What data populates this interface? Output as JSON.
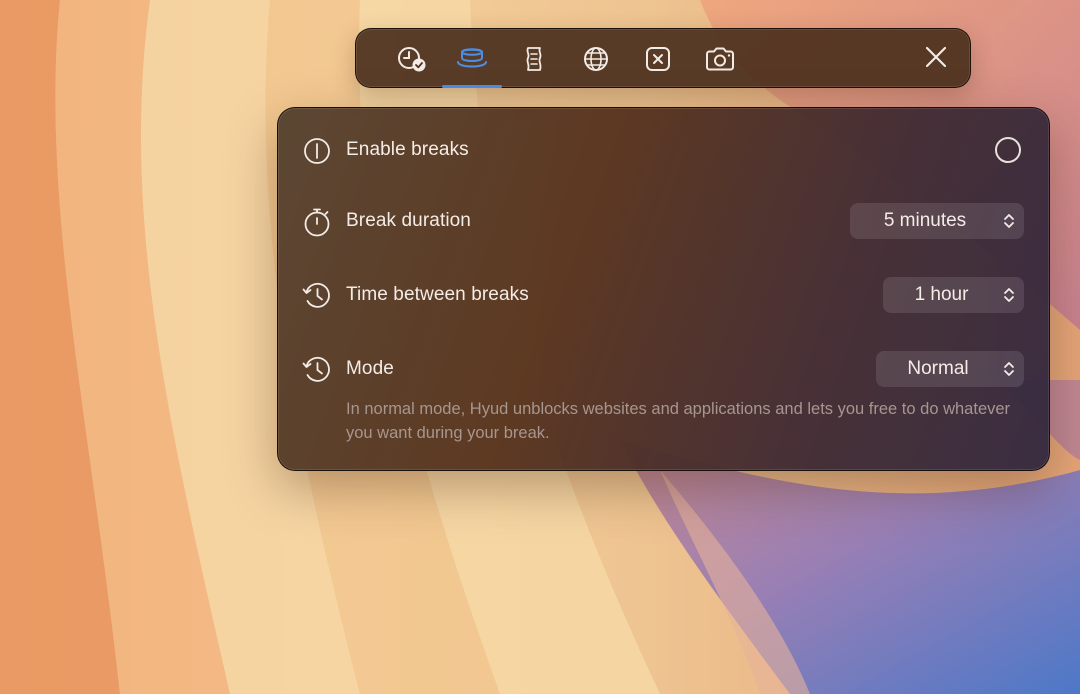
{
  "toolbar": {
    "tabs": [
      {
        "name": "schedule",
        "icon": "clock-check-icon",
        "active": false
      },
      {
        "name": "breaks",
        "icon": "coffee-cup-icon",
        "active": true
      },
      {
        "name": "rules",
        "icon": "scroll-icon",
        "active": false
      },
      {
        "name": "websites",
        "icon": "globe-icon",
        "active": false
      },
      {
        "name": "apps",
        "icon": "x-square-icon",
        "active": false
      },
      {
        "name": "screenshot",
        "icon": "camera-icon",
        "active": false
      }
    ],
    "close_icon": "close-icon",
    "active_color": "#4a8ee8"
  },
  "panel": {
    "enable_breaks": {
      "label": "Enable breaks",
      "icon": "power-icon",
      "enabled": false
    },
    "break_duration": {
      "label": "Break duration",
      "icon": "stopwatch-icon",
      "value": "5 minutes"
    },
    "time_between_breaks": {
      "label": "Time between breaks",
      "icon": "history-icon",
      "value": "1 hour"
    },
    "mode": {
      "label": "Mode",
      "icon": "history-icon",
      "value": "Normal",
      "description": "In normal mode, Hyud unblocks websites and applications and lets you free to do whatever you want during your break."
    }
  }
}
